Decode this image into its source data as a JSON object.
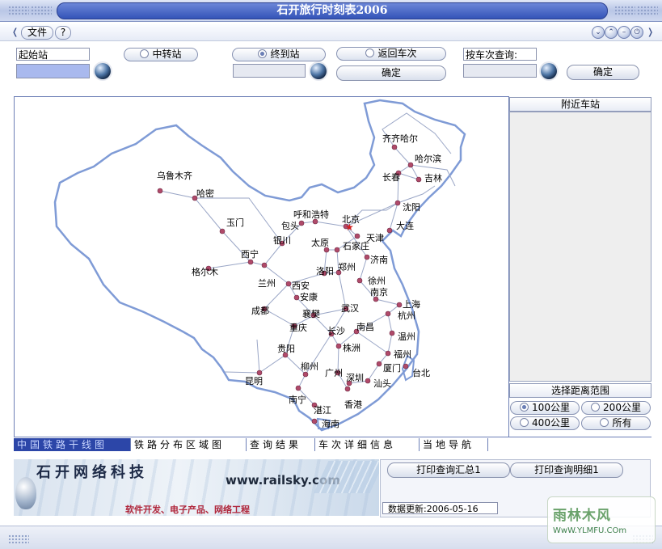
{
  "window": {
    "title": "石开旅行时刻表2006"
  },
  "menu": {
    "file": "文件",
    "help": "?"
  },
  "query": {
    "start_label": "起始站",
    "start_value": "",
    "transfer_label": "中转站",
    "end_label": "终到站",
    "return_label": "返回车次",
    "end_value": "",
    "confirm1": "确定",
    "train_label": "按车次查询:",
    "train_value": "",
    "confirm2": "确定"
  },
  "side": {
    "nearby_title": "附近车站",
    "range_title": "选择距离范围",
    "ranges": [
      "100公里",
      "200公里",
      "400公里",
      "所有"
    ],
    "selected_range": "100公里"
  },
  "tabs": [
    "中国铁路干线图",
    "铁路分布区域图",
    "查询结果",
    "车次详细信息",
    "当地导航"
  ],
  "active_tab": "中国铁路干线图",
  "map": {
    "cities": [
      {
        "name": "齐齐哈尔"
      },
      {
        "name": "哈尔滨"
      },
      {
        "name": "长春"
      },
      {
        "name": "吉林"
      },
      {
        "name": "乌鲁木齐"
      },
      {
        "name": "哈密"
      },
      {
        "name": "沈阳"
      },
      {
        "name": "呼和浩特"
      },
      {
        "name": "北京"
      },
      {
        "name": "包头"
      },
      {
        "name": "大连"
      },
      {
        "name": "玉门"
      },
      {
        "name": "天津"
      },
      {
        "name": "太原"
      },
      {
        "name": "银川"
      },
      {
        "name": "石家庄"
      },
      {
        "name": "西宁"
      },
      {
        "name": "济南"
      },
      {
        "name": "郑州"
      },
      {
        "name": "格尔木"
      },
      {
        "name": "兰州"
      },
      {
        "name": "洛阳"
      },
      {
        "name": "徐州"
      },
      {
        "name": "西安"
      },
      {
        "name": "南京"
      },
      {
        "name": "安康"
      },
      {
        "name": "上海"
      },
      {
        "name": "成都"
      },
      {
        "name": "武汉"
      },
      {
        "name": "杭州"
      },
      {
        "name": "襄樊"
      },
      {
        "name": "重庆"
      },
      {
        "name": "南昌"
      },
      {
        "name": "长沙"
      },
      {
        "name": "温州"
      },
      {
        "name": "贵阳"
      },
      {
        "name": "株洲"
      },
      {
        "name": "福州"
      },
      {
        "name": "柳州"
      },
      {
        "name": "广州"
      },
      {
        "name": "深圳"
      },
      {
        "name": "厦门"
      },
      {
        "name": "台北"
      },
      {
        "name": "昆明"
      },
      {
        "name": "汕头"
      },
      {
        "name": "南宁"
      },
      {
        "name": "香港"
      },
      {
        "name": "湛江"
      },
      {
        "name": "海南"
      }
    ]
  },
  "footer": {
    "company": "石开网络科技",
    "url": "www.railsky.com",
    "slogan": "软件开发、电子产品、网络工程",
    "print_summary": "打印查询汇总1",
    "print_detail": "打印查询明细1",
    "update_label": "数据更新:",
    "update_date": "2006-05-16"
  },
  "watermark": {
    "text": "雨林木风",
    "url": "WwW.YLMFU.COm"
  },
  "colors": {
    "title_blue": "#3454b8",
    "tab_active": "#2c46a8",
    "map_border": "#7f9bd6",
    "rail": "#9aa6c6",
    "city_dot": "#b04a6a"
  }
}
